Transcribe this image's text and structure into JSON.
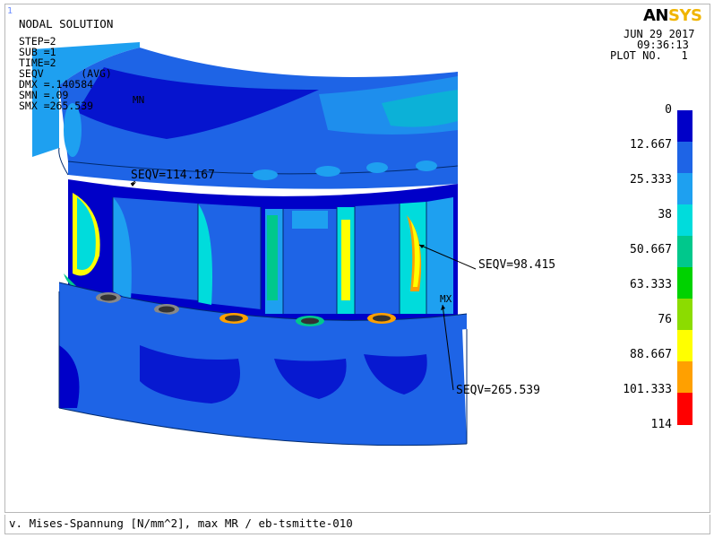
{
  "window_number": "1",
  "header": {
    "title": "NODAL SOLUTION",
    "lines": [
      "STEP=2",
      "SUB =1",
      "TIME=2",
      "SEQV      (AVG)",
      "DMX =.140584",
      "SMN =.09",
      "SMX =265.539"
    ]
  },
  "logo": {
    "part1": "AN",
    "part2": "SYS",
    "color1": "#000000",
    "color2": "#f0b400"
  },
  "date_block": {
    "date": "JUN 29 2017",
    "time": "09:36:13",
    "plot_no": "PLOT NO.   1"
  },
  "legend": {
    "labels": [
      "0",
      "12.667",
      "25.333",
      "38",
      "50.667",
      "63.333",
      "76",
      "88.667",
      "101.333",
      "114"
    ],
    "colors": [
      "#0000c8",
      "#1e64e6",
      "#1ea0f0",
      "#00dcdc",
      "#00c88c",
      "#00d200",
      "#8cdc00",
      "#ffff00",
      "#ffa000",
      "#ff0000"
    ]
  },
  "annotations": {
    "seqv_top": "SEQV=114.167",
    "seqv_right": "SEQV=98.415",
    "seqv_max": "SEQV=265.539",
    "mx": "MX",
    "mn": "MN"
  },
  "caption": "v. Mises-Spannung [N/mm^2], max MR / eb-tsmitte-010"
}
